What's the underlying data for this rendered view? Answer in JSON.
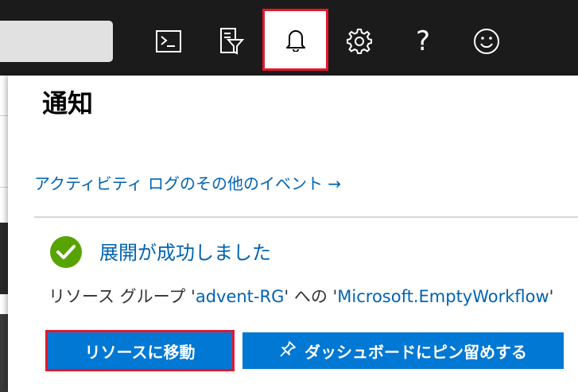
{
  "topbar": {
    "buttons": [
      {
        "name": "cloud-shell",
        "icon": "terminal-icon"
      },
      {
        "name": "directory-filter",
        "icon": "filter-icon"
      },
      {
        "name": "notifications",
        "icon": "bell-icon",
        "active": true
      },
      {
        "name": "settings",
        "icon": "gear-icon"
      },
      {
        "name": "help",
        "icon": "question-icon",
        "glyph": "?"
      },
      {
        "name": "feedback",
        "icon": "smiley-icon"
      }
    ],
    "colors": {
      "background": "#1b1b1b",
      "highlight": "#e3172d"
    }
  },
  "panel": {
    "title": "通知",
    "activity_link": "アクティビティ ログのその他のイベント →",
    "notification": {
      "title": "展開が成功しました",
      "body_prefix": "リソース グループ '",
      "resource_group": "advent-RG",
      "body_middle": "' への '",
      "deployment": "Microsoft.EmptyWorkflow",
      "body_suffix": "'",
      "status_icon": "check-circle-icon",
      "status_color": "#57a300"
    },
    "buttons": {
      "go_to_resource": "リソースに移動",
      "pin_dashboard": "ダッシュボードにピン留めする"
    },
    "colors": {
      "link": "#0063b1",
      "button": "#0078d4"
    }
  }
}
